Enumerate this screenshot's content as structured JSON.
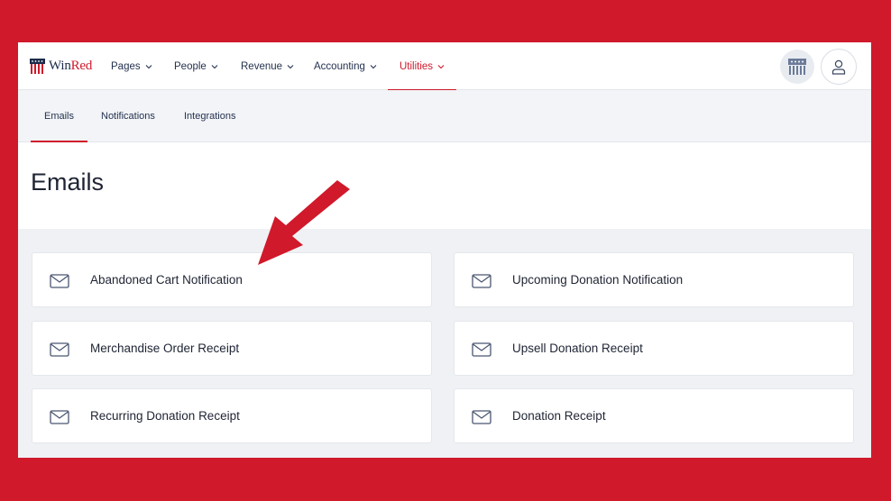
{
  "brand": {
    "name_part1": "Win",
    "name_part2": "Red",
    "accent": "#d0192b"
  },
  "nav": [
    {
      "label": "Pages"
    },
    {
      "label": "People"
    },
    {
      "label": "Revenue"
    },
    {
      "label": "Accounting"
    },
    {
      "label": "Utilities",
      "active": true
    }
  ],
  "subnav": [
    {
      "label": "Emails",
      "active": true
    },
    {
      "label": "Notifications"
    },
    {
      "label": "Integrations"
    }
  ],
  "page": {
    "title": "Emails"
  },
  "cards": [
    {
      "label": "Abandoned Cart Notification",
      "icon": "envelope-icon"
    },
    {
      "label": "Upcoming Donation Notification",
      "icon": "envelope-icon"
    },
    {
      "label": "Merchandise Order Receipt",
      "icon": "envelope-icon"
    },
    {
      "label": "Upsell Donation Receipt",
      "icon": "envelope-icon"
    },
    {
      "label": "Recurring Donation Receipt",
      "icon": "envelope-icon"
    },
    {
      "label": "Donation Receipt",
      "icon": "envelope-icon"
    }
  ],
  "annotation": {
    "icon": "arrow-pointer-icon",
    "color": "#d0192b"
  }
}
